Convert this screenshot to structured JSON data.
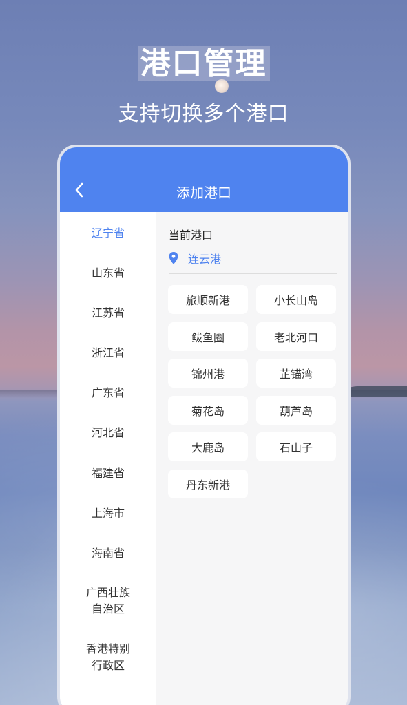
{
  "hero": {
    "title": "港口管理",
    "subtitle": "支持切换多个港口"
  },
  "appbar": {
    "title": "添加港口",
    "back_icon": "chevron-left-icon"
  },
  "sidebar": {
    "items": [
      {
        "label": "辽宁省",
        "active": true
      },
      {
        "label": "山东省"
      },
      {
        "label": "江苏省"
      },
      {
        "label": "浙江省"
      },
      {
        "label": "广东省"
      },
      {
        "label": "河北省"
      },
      {
        "label": "福建省"
      },
      {
        "label": "上海市"
      },
      {
        "label": "海南省"
      },
      {
        "label": "广西壮族\n自治区"
      },
      {
        "label": "香港特别\n行政区"
      }
    ]
  },
  "current": {
    "label": "当前港口",
    "port": "连云港",
    "icon": "location-pin-icon"
  },
  "ports": [
    "旅顺新港",
    "小长山岛",
    "鲅鱼圈",
    "老北河口",
    "锦州港",
    "芷锚湾",
    "菊花岛",
    "葫芦岛",
    "大鹿岛",
    "石山子",
    "丹东新港"
  ],
  "colors": {
    "accent": "#4f83ef",
    "text": "#333333",
    "panel_bg": "#f6f6f7"
  }
}
